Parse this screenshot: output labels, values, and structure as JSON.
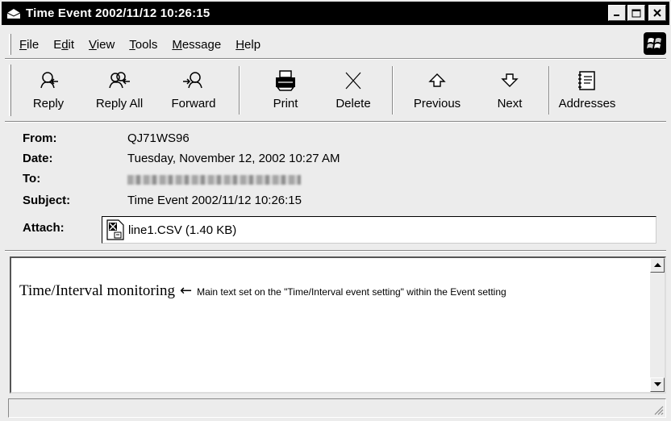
{
  "window": {
    "title": "Time Event 2002/11/12 10:26:15",
    "controls": [
      "_",
      "□",
      "X"
    ]
  },
  "menu": {
    "items": [
      {
        "underline": "F",
        "rest": "ile"
      },
      {
        "pre": "E",
        "underline": "d",
        "rest": "it"
      },
      {
        "underline": "V",
        "rest": "iew"
      },
      {
        "underline": "T",
        "rest": "ools"
      },
      {
        "underline": "M",
        "rest": "essage"
      },
      {
        "underline": "H",
        "rest": "elp"
      }
    ]
  },
  "toolbar": {
    "reply": "Reply",
    "reply_all": "Reply All",
    "forward": "Forward",
    "print": "Print",
    "delete": "Delete",
    "previous": "Previous",
    "next": "Next",
    "addresses": "Addresses"
  },
  "header": {
    "from_label": "From:",
    "from_value": "QJ71WS96",
    "date_label": "Date:",
    "date_value": "Tuesday, November 12, 2002 10:27 AM",
    "to_label": "To:",
    "subject_label": "Subject:",
    "subject_value": "Time Event 2002/11/12 10:26:15",
    "attach_label": "Attach:",
    "attach_value": "line1.CSV (1.40 KB)"
  },
  "body": {
    "main_text": "Time/Interval monitoring",
    "arrow": "←",
    "note": "Main text set on the \"Time/Interval event setting\" within the Event setting"
  }
}
